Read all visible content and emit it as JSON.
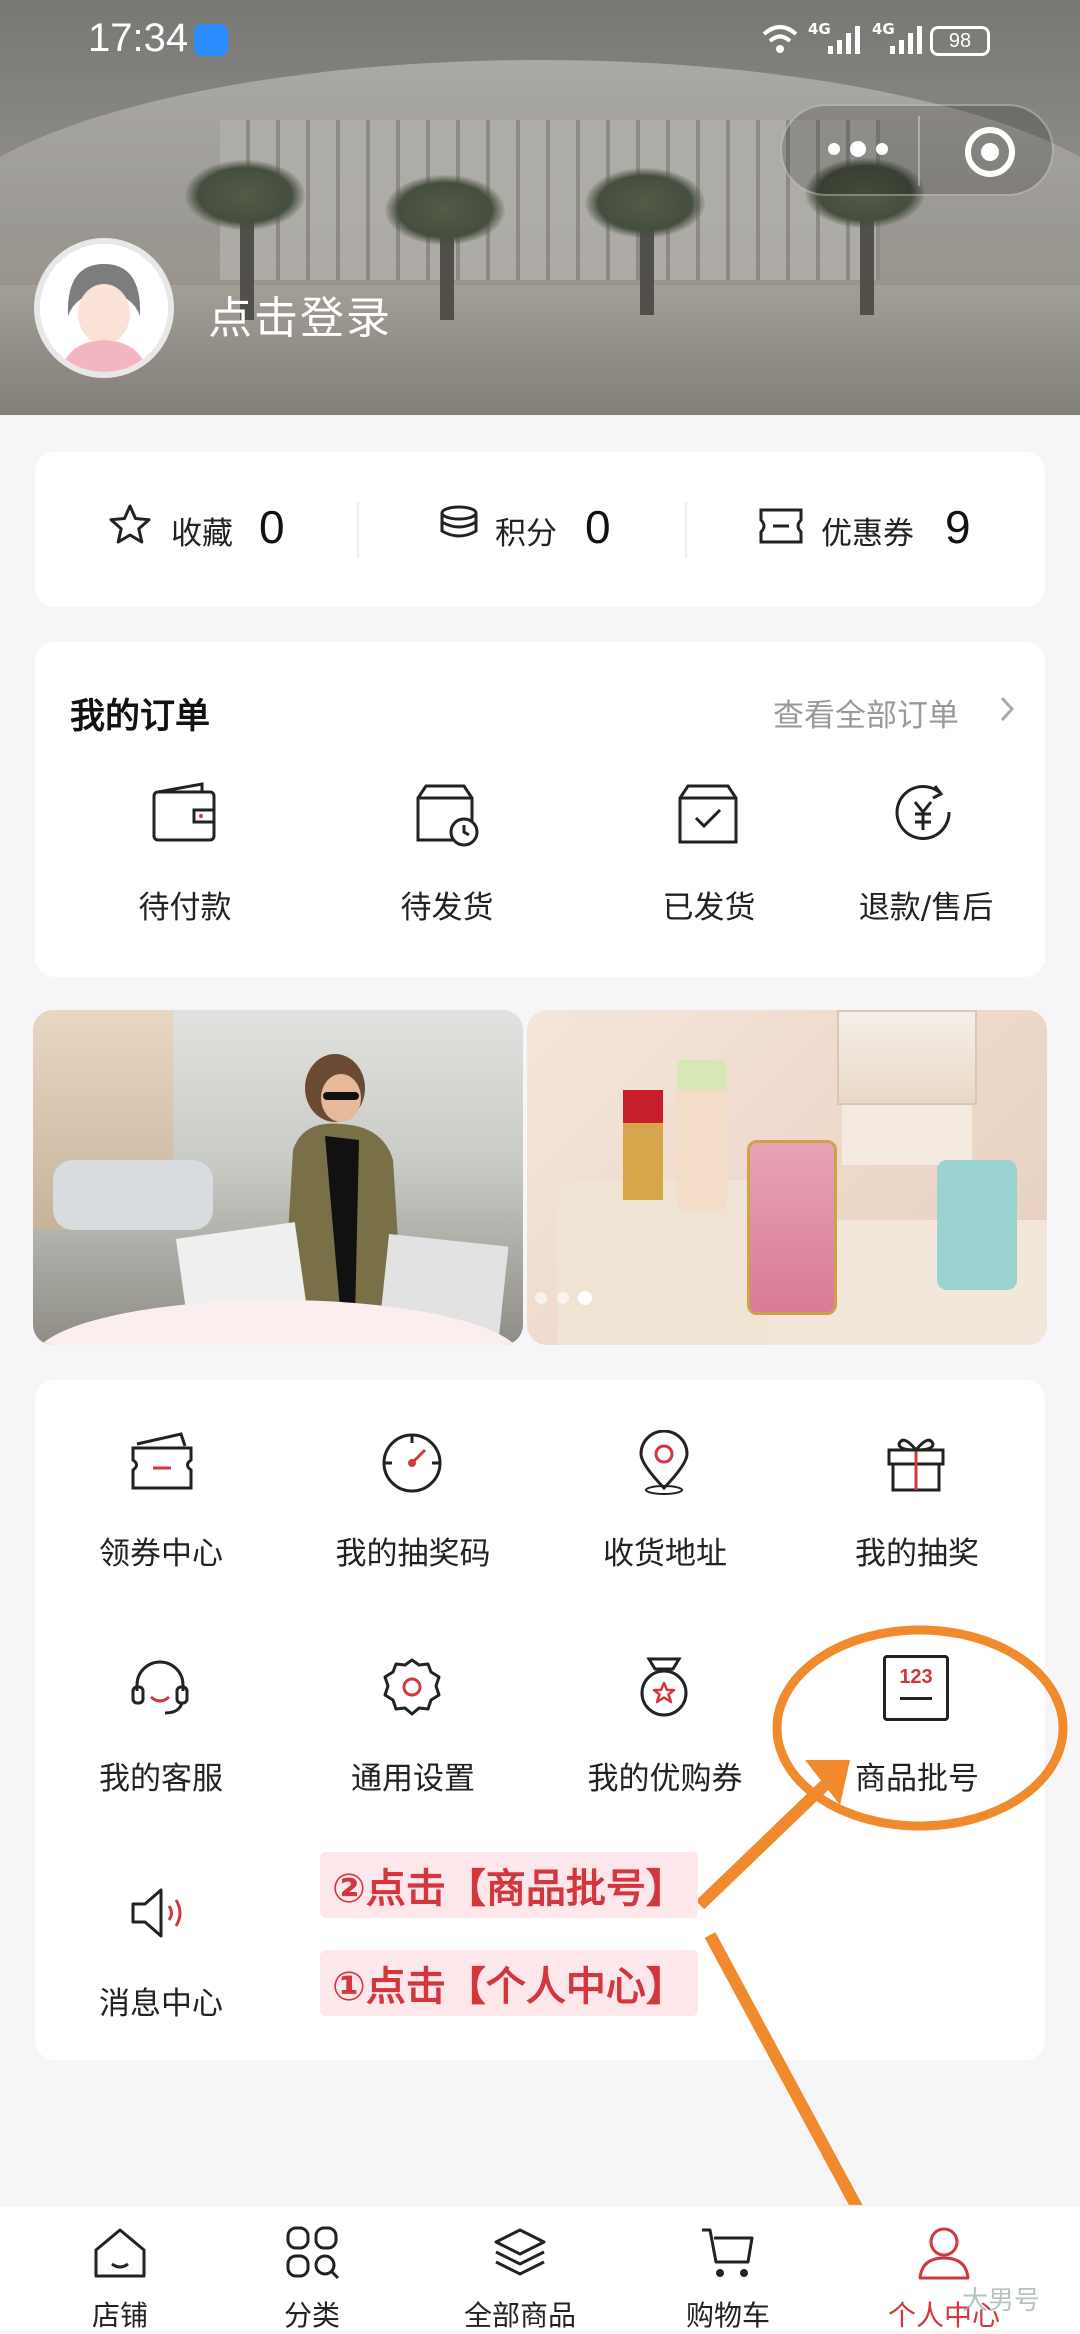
{
  "status_bar": {
    "time": "17:34",
    "network": "4G",
    "battery": "98"
  },
  "header": {
    "login_text": "点击登录",
    "menu_icon": "more-dots-icon",
    "target_icon": "close-target-icon"
  },
  "stats": [
    {
      "label": "收藏",
      "value": "0",
      "icon": "star-icon"
    },
    {
      "label": "积分",
      "value": "0",
      "icon": "coins-icon"
    },
    {
      "label": "优惠券",
      "value": "9",
      "icon": "ticket-icon"
    }
  ],
  "orders": {
    "title": "我的订单",
    "view_all": "查看全部订单",
    "items": [
      {
        "label": "待付款",
        "icon": "wallet-icon"
      },
      {
        "label": "待发货",
        "icon": "box-clock-icon"
      },
      {
        "label": "已发货",
        "icon": "box-check-icon"
      },
      {
        "label": "退款/售后",
        "icon": "refund-icon"
      }
    ]
  },
  "services": [
    {
      "label": "领券中心",
      "icon": "coupon-icon"
    },
    {
      "label": "我的抽奖码",
      "icon": "dial-icon"
    },
    {
      "label": "收货地址",
      "icon": "location-icon"
    },
    {
      "label": "我的抽奖",
      "icon": "gift-icon"
    },
    {
      "label": "我的客服",
      "icon": "headset-icon"
    },
    {
      "label": "通用设置",
      "icon": "gear-icon"
    },
    {
      "label": "我的优购券",
      "icon": "medal-icon"
    },
    {
      "label": "商品批号",
      "icon": "batch-number-icon",
      "icon_text": "123"
    },
    {
      "label": "消息中心",
      "icon": "speaker-icon"
    }
  ],
  "annotations": {
    "step2": "②点击【商品批号】",
    "step1": "①点击【个人中心】"
  },
  "tabbar": [
    {
      "label": "店铺",
      "icon": "home-icon"
    },
    {
      "label": "分类",
      "icon": "category-icon"
    },
    {
      "label": "全部商品",
      "icon": "layers-icon"
    },
    {
      "label": "购物车",
      "icon": "cart-icon"
    },
    {
      "label": "个人中心",
      "icon": "user-icon",
      "active": true
    }
  ],
  "watermark": "大男号",
  "colors": {
    "accent": "#d2373d",
    "annotation": "#f08a2c",
    "active_tab": "#d2373d"
  }
}
